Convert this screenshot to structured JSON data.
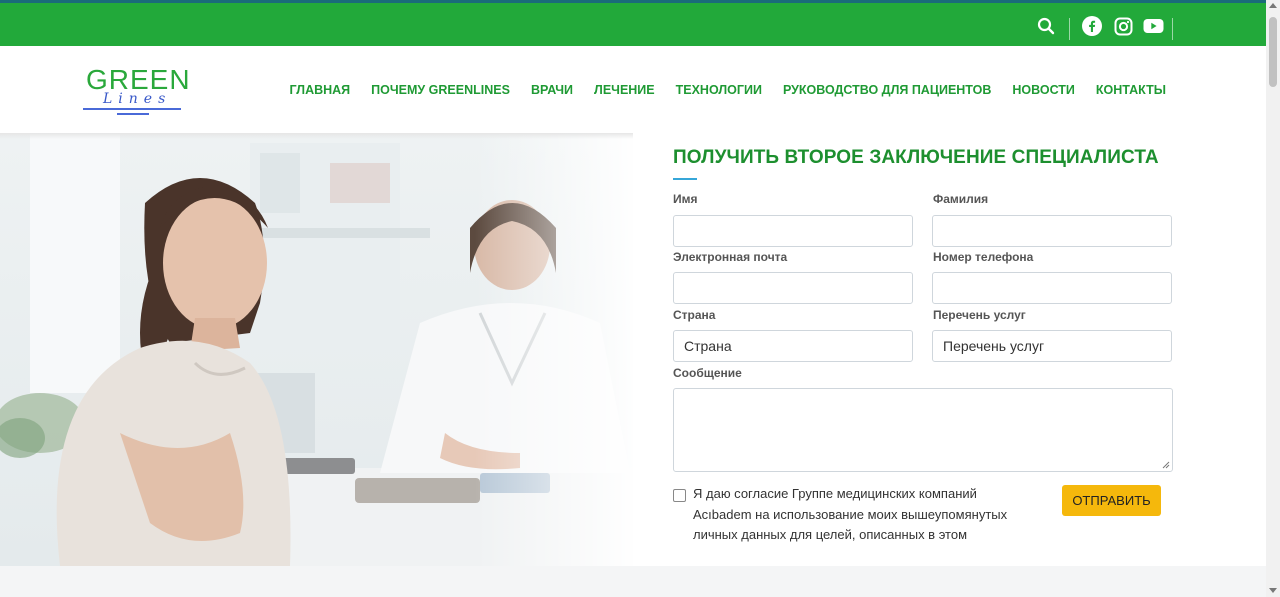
{
  "colors": {
    "topbar": "#22a93a",
    "nav": "#1f9a34",
    "title": "#1d8f2f",
    "accent": "#36a6d8",
    "submit": "#f5b80c"
  },
  "topbar": {
    "icons": [
      "search-icon",
      "facebook-icon",
      "instagram-icon",
      "youtube-icon"
    ]
  },
  "logo": {
    "word": "GREEN",
    "script": "Lines"
  },
  "nav": {
    "items": [
      {
        "label": "ГЛАВНАЯ"
      },
      {
        "label": "ПОЧЕМУ GREENLINES"
      },
      {
        "label": "ВРАЧИ"
      },
      {
        "label": "ЛЕЧЕНИЕ"
      },
      {
        "label": "ТЕХНОЛОГИИ"
      },
      {
        "label": "РУКОВОДСТВО ДЛЯ ПАЦИЕНТОВ"
      },
      {
        "label": "НОВОСТИ"
      },
      {
        "label": "КОНТАКТЫ"
      }
    ]
  },
  "form": {
    "title": "ПОЛУЧИТЬ ВТОРОЕ ЗАКЛЮЧЕНИЕ СПЕЦИАЛИСТА",
    "first_name_label": "Имя",
    "last_name_label": "Фамилия",
    "email_label": "Электронная почта",
    "phone_label": "Номер телефона",
    "country_label": "Страна",
    "country_value": "Страна",
    "services_label": "Перечень услуг",
    "services_value": "Перечень услуг",
    "message_label": "Сообщение",
    "consent_text": "Я даю согласие Группе медицинских компаний Acıbadem на использование моих вышеупомянутых личных данных для целей, описанных в этом",
    "submit_label": "ОТПРАВИТЬ"
  }
}
